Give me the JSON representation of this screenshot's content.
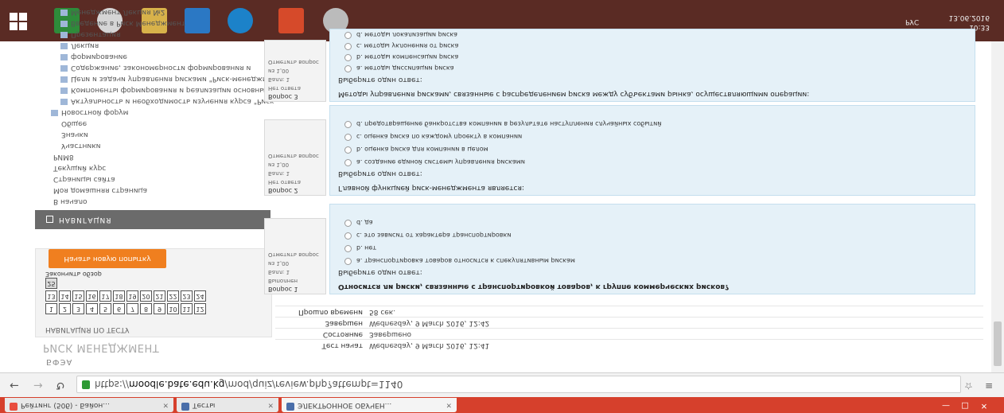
{
  "browser": {
    "tabs": [
      {
        "label": "Рейтинг (50б) - Бaйoн...",
        "active": false
      },
      {
        "label": "Тесты",
        "active": false
      },
      {
        "label": "ЭЛЕКТРОННОЕ ОБУЧЕН...",
        "active": true
      }
    ],
    "url": {
      "scheme": "https",
      "host": "moodle.bate.edu.kg",
      "path": "/mod/quiz/review.php?attempt=1140"
    }
  },
  "sidebar": {
    "brand": "БФЭА",
    "course_title": "РИСК МЕНЕДЖМЕНТ",
    "quiz_nav_title": "НАВИГАЦИЯ ПО ТЕСТУ",
    "question_numbers_row1": [
      "1",
      "2",
      "3",
      "4",
      "5",
      "6",
      "7",
      "8",
      "9",
      "10",
      "11",
      "12"
    ],
    "question_numbers_row2": [
      "13",
      "14",
      "15",
      "16",
      "17",
      "18",
      "19",
      "20",
      "21",
      "22",
      "23",
      "24"
    ],
    "question_numbers_row3": [
      "25"
    ],
    "finish_review": "Закончить обзор",
    "new_attempt_button": "Начать новую попытку",
    "navigation_label": "НАВИГАЦИЯ",
    "nav_items": [
      "В начало",
      "Моя домашняя страница",
      "Страницы сайта",
      "Текущий курс",
      "РИМ8",
      "Участники",
      "Значки",
      "Общее",
      "Новостной форум",
      "Актуальность и необходимость изучения курса \"Риск-",
      "Компоненты формирования и реализации основных \"ИСП\"",
      "Цели и задачи управления рисками \"Риск-менеджмент\"",
      "Содержание, закономерности формирования и",
      "формирование",
      "Лекция",
      "Презентация",
      "Введение в Риск Менеджмент",
      "Менеджмент Лекция №2"
    ]
  },
  "summary": [
    {
      "key": "Тест начат",
      "value": "Wednesday, 9 March 2016, 12:41"
    },
    {
      "key": "Состояние",
      "value": "Завершено"
    },
    {
      "key": "Завершен",
      "value": "Wednesday, 9 March 2016, 12:42"
    },
    {
      "key": "Прошло времени",
      "value": "58 сек."
    }
  ],
  "questions": [
    {
      "number": "Вопрос 1",
      "state": "Выполнен",
      "mark": "Балл: 1",
      "of_total": "из 1,00",
      "flag": "Отметить вопрос",
      "text": "Относится ли риски, связанные с транспортировкой товаров, к группе коммерческих рисков?",
      "prompt": "Выберите один ответ:",
      "options": [
        "a. транспортировка товаров относится к спекулятивным рискам",
        "b. нет",
        "c. это зависит от характера транспортировки",
        "d. да"
      ]
    },
    {
      "number": "Вопрос 2",
      "state": "Нет ответа",
      "mark": "Балл: 1",
      "of_total": "из 1,00",
      "flag": "Отметить вопрос",
      "text": "Главной функцией риск-менеджмента является:",
      "prompt": "Выберите один ответ:",
      "options": [
        "a. создание единой системы управления рисками",
        "b. оценка риска для компании в целом",
        "c. оценка риска по каждому проекту в компании",
        "d. предотвращение банкротства компании в результате наступления случайных событий"
      ]
    },
    {
      "number": "Вопрос 3",
      "state": "Нет ответа",
      "mark": "Балл: 1",
      "of_total": "из 1,00",
      "flag": "Отметить вопрос",
      "text": "Методы управления рисками, связанные с распределением риска между субъектами рынка, осуществляющими операции:",
      "prompt": "Выберите один ответ:",
      "options": [
        "a. методы диссипации риска",
        "b. методы компенсации риска",
        "c. методы уклонения от риска",
        "d. методы локализации риска"
      ]
    }
  ],
  "taskbar": {
    "lang": "РУС",
    "time": "10:33",
    "date": "13.06.2016"
  }
}
